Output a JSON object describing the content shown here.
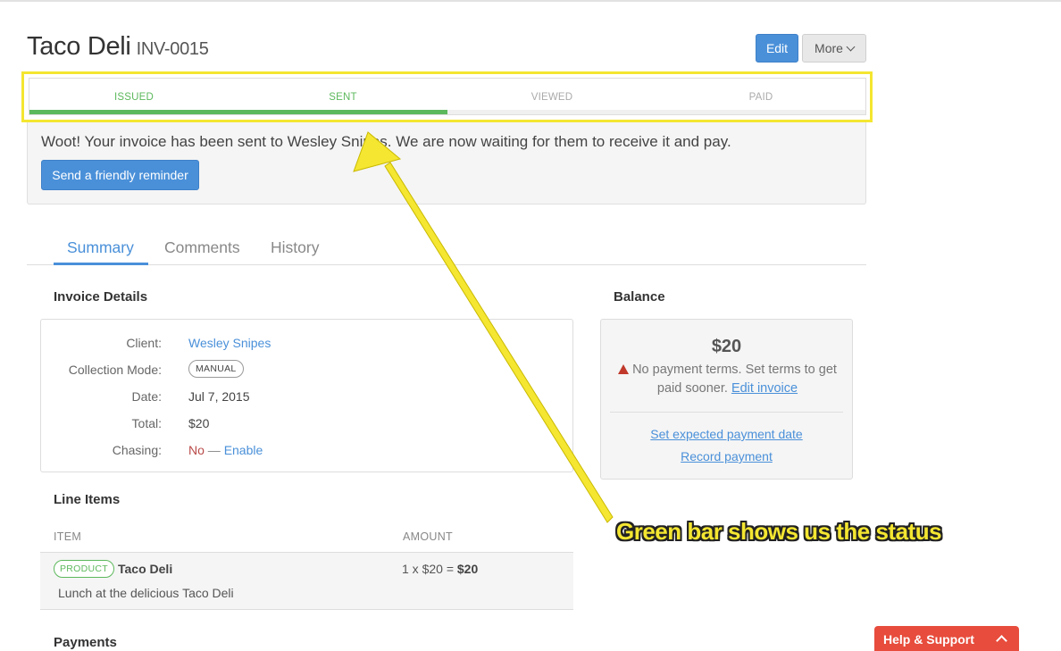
{
  "header": {
    "client_name": "Taco Deli",
    "invoice_number": "INV-0015",
    "edit_label": "Edit",
    "more_label": "More"
  },
  "status": {
    "steps": [
      "ISSUED",
      "SENT",
      "VIEWED",
      "PAID"
    ],
    "completed_steps": 2,
    "progress_fraction": 0.5,
    "progress_color": "#5cb85c"
  },
  "message": {
    "text": "Woot! Your invoice has been sent to Wesley Snipes. We are now waiting for them to receive it and pay.",
    "reminder_label": "Send a friendly reminder"
  },
  "tabs": [
    {
      "label": "Summary",
      "active": true
    },
    {
      "label": "Comments",
      "active": false
    },
    {
      "label": "History",
      "active": false
    }
  ],
  "invoice_details": {
    "heading": "Invoice Details",
    "client_label": "Client:",
    "client_value": "Wesley Snipes",
    "mode_label": "Collection Mode:",
    "mode_value": "MANUAL",
    "date_label": "Date:",
    "date_value": "Jul 7, 2015",
    "total_label": "Total:",
    "total_value": "$20",
    "chasing_label": "Chasing:",
    "chasing_value": "No",
    "chasing_separator": "—",
    "chasing_action": "Enable"
  },
  "balance": {
    "heading": "Balance",
    "amount": "$20",
    "note": "No payment terms. Set terms to get paid sooner.",
    "edit_link": "Edit invoice",
    "set_date_link": "Set expected payment date",
    "record_link": "Record payment"
  },
  "line_items": {
    "heading": "Line Items",
    "col_item": "ITEM",
    "col_amount": "AMOUNT",
    "rows": [
      {
        "tag": "PRODUCT",
        "name": "Taco Deli",
        "description": "Lunch at the delicious Taco Deli",
        "quantity_expr": "1 x $20 =",
        "amount": "$20"
      }
    ]
  },
  "payments": {
    "heading": "Payments"
  },
  "annotation": {
    "text": "Green bar shows us the status",
    "color": "#f4e631"
  },
  "help": {
    "label": "Help & Support"
  }
}
